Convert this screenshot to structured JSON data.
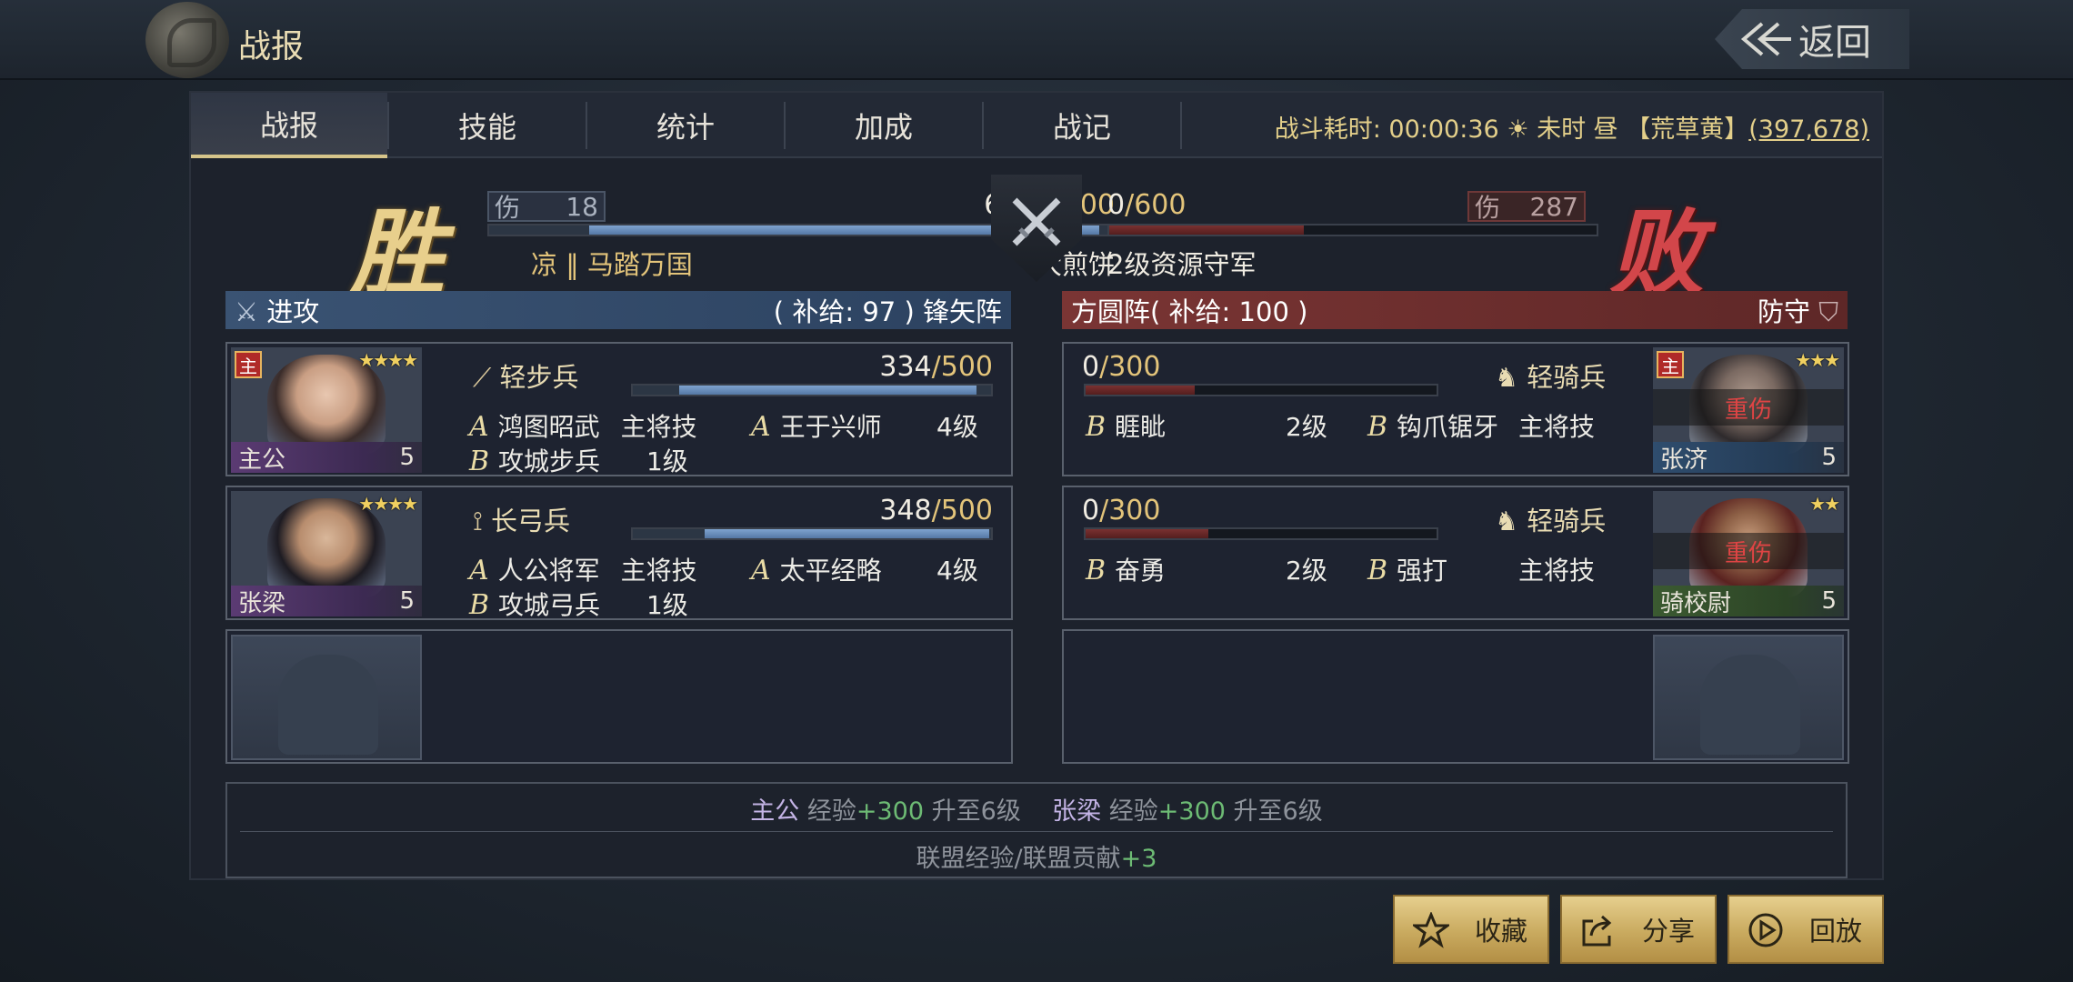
{
  "header": {
    "title": "战报",
    "back_label": "返回"
  },
  "tabs": [
    {
      "label": "战报",
      "active": true
    },
    {
      "label": "技能"
    },
    {
      "label": "统计"
    },
    {
      "label": "加成"
    },
    {
      "label": "战记"
    }
  ],
  "battle_info": {
    "duration_label": "战斗耗时:",
    "duration": "00:00:36",
    "time_of_day": "未时 昼",
    "location": "【荒草黄】",
    "coords": "(397,678)"
  },
  "result": {
    "win_char": "胜",
    "lose_char": "败",
    "attacker": {
      "damage_label": "伤",
      "damage": "18",
      "troops": "682",
      "troops_max": "/1000",
      "troops_fraction": 0.682,
      "name_left": "凉 ‖ 马踏万国",
      "name_right": "大煎饼"
    },
    "defender": {
      "damage_label": "伤",
      "damage": "287",
      "troops": "0",
      "troops_max": "/600",
      "troops_fraction": 0.0,
      "name": "2级资源守军"
    }
  },
  "attack_banner": {
    "label": "进攻",
    "supply": "( 补给: 97 )",
    "formation": "锋矢阵"
  },
  "defense_banner": {
    "formation": "方圆阵",
    "supply": "( 补给: 100 )",
    "label": "防守"
  },
  "attackers": [
    {
      "name": "主公",
      "level": "5",
      "lord_badge": "主",
      "stars": "★★★★",
      "troop_type": "轻步兵",
      "troops": "334",
      "troops_max": "/500",
      "troops_fraction": 0.668,
      "skills": [
        {
          "grade": "A",
          "name": "鸿图昭武",
          "level": "主将技"
        },
        {
          "grade": "A",
          "name": "王于兴师",
          "level": "4级"
        },
        {
          "grade": "B",
          "name": "攻城步兵",
          "level": "1级"
        }
      ]
    },
    {
      "name": "张梁",
      "level": "5",
      "stars": "★★★★",
      "troop_type": "长弓兵",
      "troops": "348",
      "troops_max": "/500",
      "troops_fraction": 0.696,
      "skills": [
        {
          "grade": "A",
          "name": "人公将军",
          "level": "主将技"
        },
        {
          "grade": "A",
          "name": "太平经略",
          "level": "4级"
        },
        {
          "grade": "B",
          "name": "攻城弓兵",
          "level": "1级"
        }
      ]
    }
  ],
  "defenders": [
    {
      "name": "张济",
      "level": "5",
      "lord_badge": "主",
      "stars": "★★★",
      "status": "重伤",
      "troop_type": "轻骑兵",
      "troops": "0",
      "troops_max": "/300",
      "troops_fraction": 0.0,
      "skills": [
        {
          "grade": "B",
          "name": "睚眦",
          "level": "2级"
        },
        {
          "grade": "B",
          "name": "钩爪锯牙",
          "level": "主将技"
        }
      ]
    },
    {
      "name": "骑校尉",
      "level": "5",
      "stars": "★★",
      "status": "重伤",
      "troop_type": "轻骑兵",
      "troops": "0",
      "troops_max": "/300",
      "troops_fraction": 0.0,
      "skills": [
        {
          "grade": "B",
          "name": "奋勇",
          "level": "2级"
        },
        {
          "grade": "B",
          "name": "强打",
          "level": "主将技"
        }
      ]
    }
  ],
  "experience": {
    "line1": [
      {
        "name": "主公",
        "label": "经验",
        "amount": "+300",
        "result": "升至6级"
      },
      {
        "name": "张梁",
        "label": "经验",
        "amount": "+300",
        "result": "升至6级"
      }
    ],
    "line2_label": "联盟经验/联盟贡献",
    "line2_amount": "+3"
  },
  "buttons": {
    "favorite": "收藏",
    "share": "分享",
    "replay": "回放"
  },
  "colors": {
    "gold": "#e3c47a",
    "attack_blue": "#3a5373",
    "defense_red": "#7a3534",
    "injured_red": "#e04444",
    "exp_green": "#6dbb74"
  }
}
